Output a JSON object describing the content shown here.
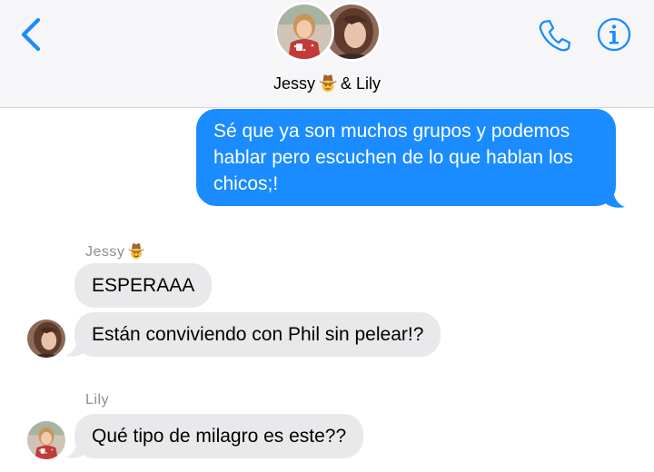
{
  "header": {
    "group_name_first": "Jessy",
    "group_name_rest": "& Lily",
    "icons": [
      "back-chevron-icon",
      "phone-icon",
      "info-icon",
      "cowboy-face-icon"
    ],
    "accent_color": "#1a8cff"
  },
  "messages": [
    {
      "direction": "outgoing",
      "text": "Sé que ya son muchos grupos y podemos hablar pero escuchen de lo que hablan los chicos;!"
    },
    {
      "direction": "incoming",
      "sender": "Jessy",
      "text": "ESPERAAA"
    },
    {
      "direction": "incoming",
      "sender": "Jessy",
      "text": "Están conviviendo con Phil sin pelear!?"
    },
    {
      "direction": "incoming",
      "sender": "Lily",
      "text": "Qué tipo de milagro es este??"
    }
  ],
  "colors": {
    "outgoing_bubble": "#1a8cff",
    "incoming_bubble": "#e9e9eb",
    "sender_label": "#8e8e93",
    "header_bg": "#f6f6f8"
  }
}
